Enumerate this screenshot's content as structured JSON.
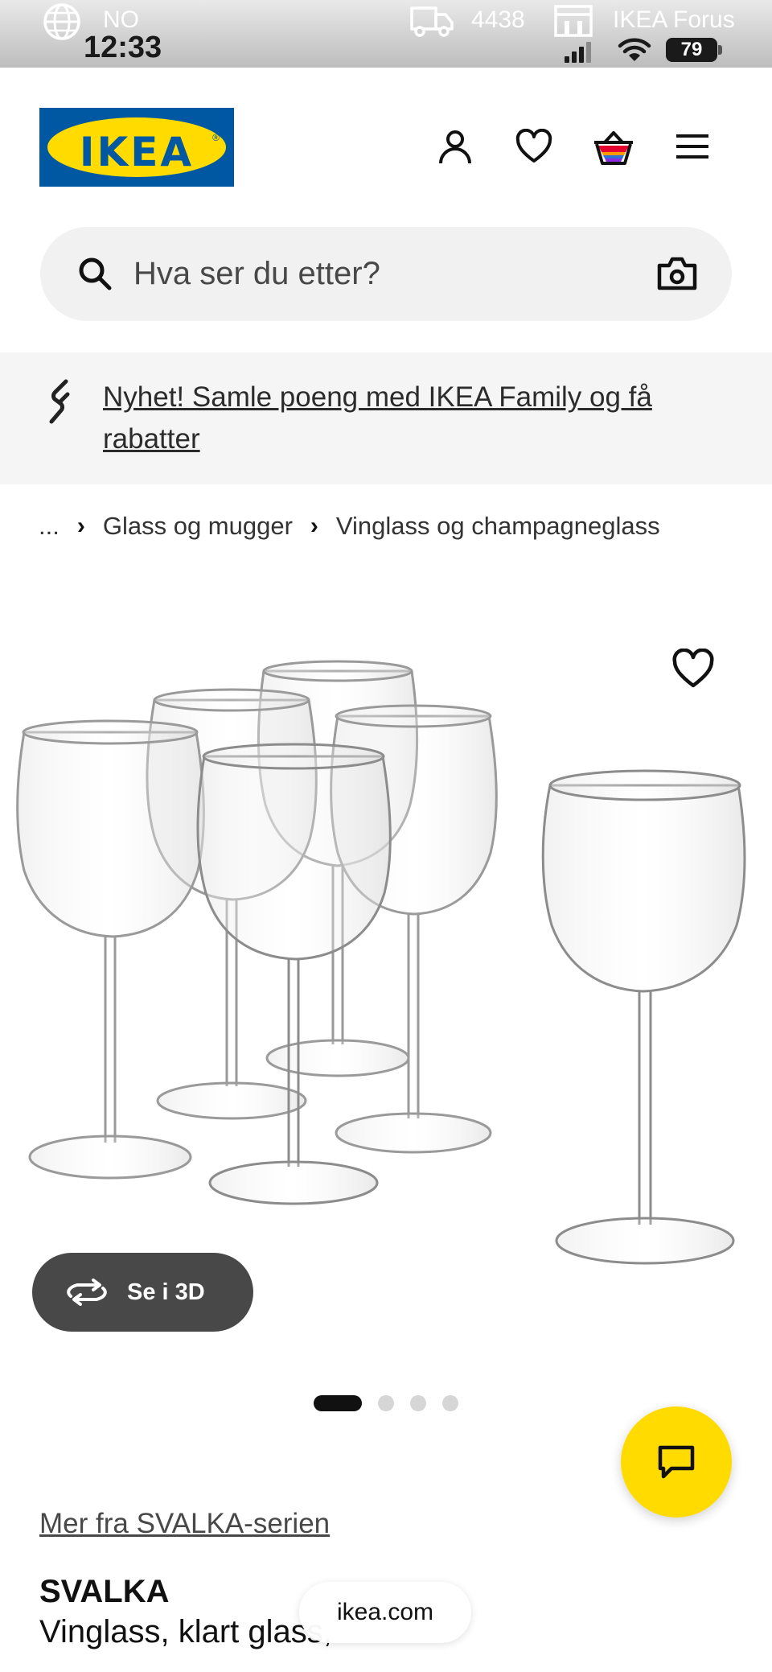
{
  "status_bar": {
    "country": "NO",
    "postal_code": "4438",
    "store": "IKEA Forus",
    "time": "12:33",
    "battery": "79"
  },
  "header": {
    "logo_text": "IKEA",
    "icons": [
      "user-icon",
      "heart-icon",
      "basket-icon",
      "menu-icon"
    ]
  },
  "search": {
    "placeholder": "Hva ser du etter?"
  },
  "banner": {
    "link_text": "Nyhet! Samle poeng med IKEA Family og få rabatter"
  },
  "breadcrumb": {
    "items": [
      "...",
      "Glass og mugger",
      "Vinglass og champagneglass"
    ]
  },
  "gallery": {
    "view_3d_label": "Se i 3D",
    "image_count": 4,
    "active_index": 0
  },
  "product": {
    "series_link": "Mer fra SVALKA-serien",
    "name": "SVALKA",
    "description": "Vinglass, klart glass,"
  },
  "browser": {
    "url": "ikea.com"
  },
  "colors": {
    "ikea_blue": "#0058a3",
    "ikea_yellow": "#ffdb00",
    "dark_button": "#484848"
  }
}
